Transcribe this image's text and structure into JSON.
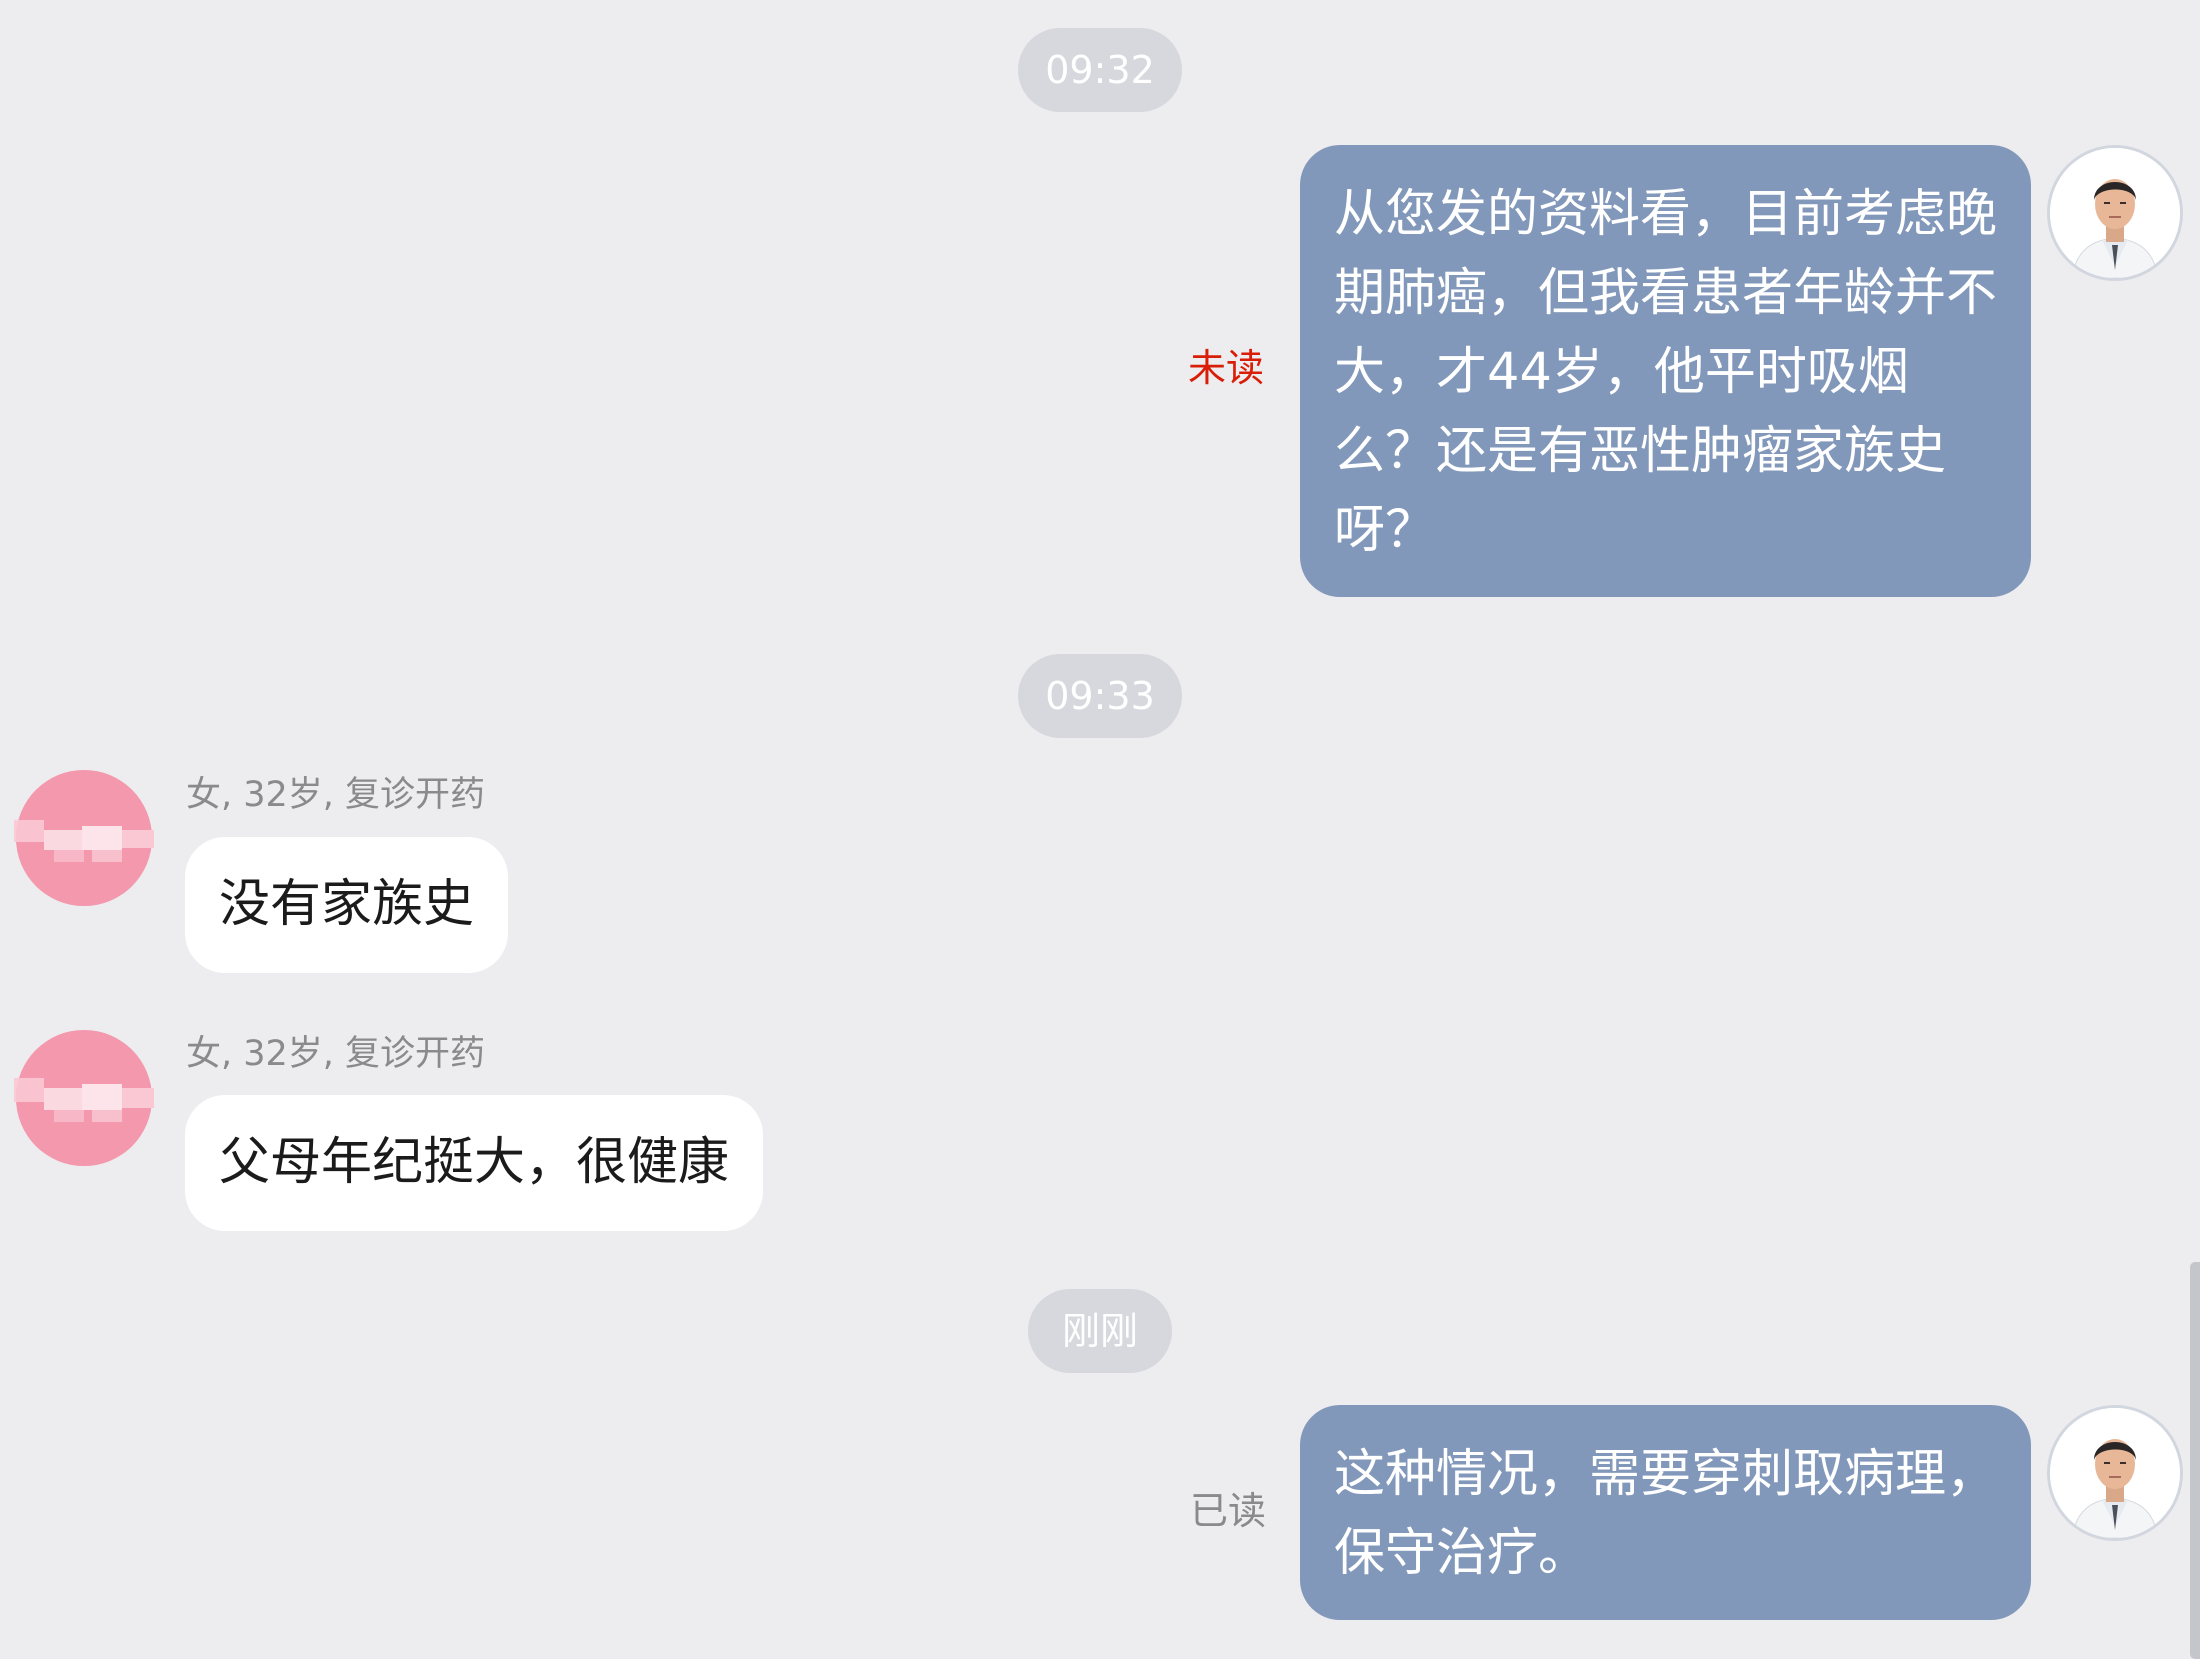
{
  "timestamps": [
    "09:32",
    "09:33",
    "刚刚"
  ],
  "messages": {
    "doctor_1": {
      "text": "从您发的资料看，目前考虑晚期肺癌，但我看患者年龄并不大，才44岁，他平时吸烟么？还是有恶性肿瘤家族史呀？",
      "status": "未读"
    },
    "patient_1": {
      "meta": "女, 32岁, 复诊开药",
      "text": "没有家族史"
    },
    "patient_2": {
      "meta": "女, 32岁, 复诊开药",
      "text": "父母年纪挺大，很健康"
    },
    "doctor_2": {
      "text": "这种情况，需要穿刺取病理，保守治疗。",
      "status": "已读"
    }
  },
  "colors": {
    "background": "#ededf0",
    "doctor_bubble": "#8298ba",
    "patient_bubble": "#ffffff",
    "unread_status": "#d81e06",
    "read_status": "#8a8a8a",
    "time_pill": "#d6d8dd",
    "patient_avatar": "#f28fa6"
  },
  "icons": {
    "doctor_avatar": "doctor-avatar",
    "patient_avatar": "blurred-patient-avatar"
  }
}
